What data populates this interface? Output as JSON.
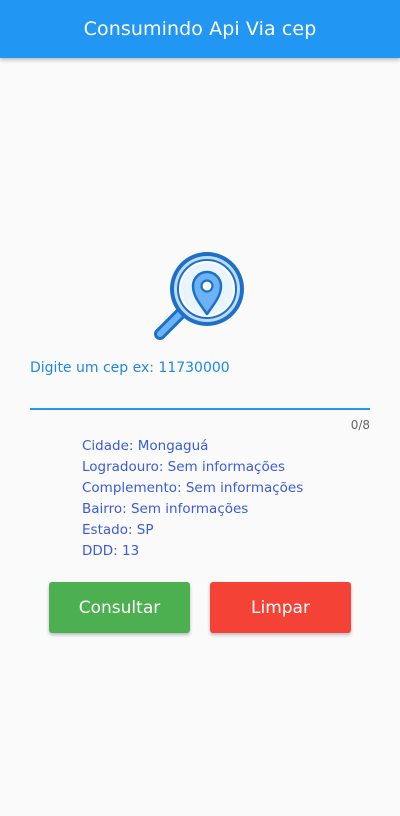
{
  "appbar": {
    "title": "Consumindo Api Via cep"
  },
  "form": {
    "label": "Digite um cep ex: 11730000",
    "value": "",
    "counter": "0/8"
  },
  "result": {
    "cidade": "Cidade: Mongaguá",
    "logradouro": "Logradouro: Sem informações",
    "complemento": "Complemento: Sem informações",
    "bairro": "Bairro: Sem informações",
    "estado": "Estado: SP",
    "ddd": "DDD: 13"
  },
  "buttons": {
    "consultar": "Consultar",
    "limpar": "Limpar"
  },
  "icons": {
    "logo": "location-search-icon"
  },
  "colors": {
    "primary": "#2196f3",
    "consultar": "#4caf50",
    "limpar": "#f44336",
    "info_text": "#3b5bdb"
  }
}
